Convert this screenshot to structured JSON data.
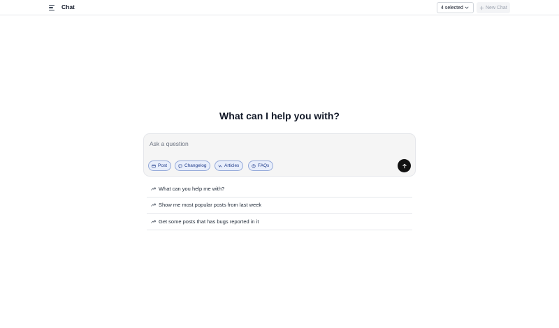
{
  "header": {
    "title": "Chat",
    "selector_label": "4 selected",
    "new_chat_label": "New Chat"
  },
  "main": {
    "heading": "What can I help you with?",
    "input_placeholder": "Ask a question",
    "chips": [
      {
        "label": "Post",
        "icon": "post-icon"
      },
      {
        "label": "Changelog",
        "icon": "changelog-icon"
      },
      {
        "label": "Articles",
        "icon": "articles-icon"
      },
      {
        "label": "FAQs",
        "icon": "faq-icon"
      }
    ],
    "suggestions": [
      "What can you help me with?",
      "Show me most popular posts from last week",
      "Get some posts that has bugs reported in it"
    ]
  },
  "colors": {
    "chip_border": "#93a8d8",
    "chip_bg": "#e8eefb",
    "send_button": "#111111"
  }
}
